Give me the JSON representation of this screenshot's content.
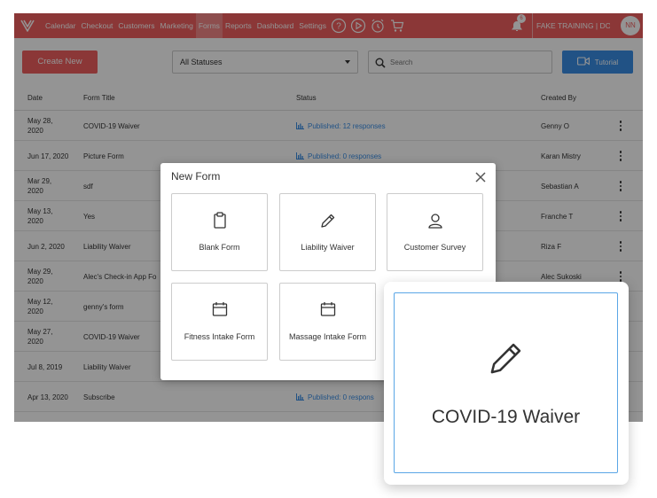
{
  "nav": {
    "items": [
      "Calendar",
      "Checkout",
      "Customers",
      "Marketing",
      "Forms",
      "Reports",
      "Dashboard",
      "Settings"
    ],
    "active": "Forms",
    "notification_count": "6",
    "account": "FAKE TRAINING | DO NO",
    "avatar_initials": "NN"
  },
  "toolbar": {
    "create_label": "Create New",
    "status_value": "All Statuses",
    "search_placeholder": "Search",
    "tutorial_label": "Tutorial"
  },
  "table": {
    "headers": {
      "date": "Date",
      "title": "Form Title",
      "status": "Status",
      "created": "Created By"
    },
    "rows": [
      {
        "date": "May 28,\n2020",
        "title": "COVID-19 Waiver",
        "status": "Published: 12 responses",
        "created": "Genny O"
      },
      {
        "date": "Jun 17, 2020",
        "title": "Picture Form",
        "status": "Published: 0 responses",
        "created": "Karan Mistry"
      },
      {
        "date": "Mar 29,\n2020",
        "title": "sdf",
        "status": "",
        "created": "Sebastian A"
      },
      {
        "date": "May 13,\n2020",
        "title": "Yes",
        "status": "",
        "created": "Franche T"
      },
      {
        "date": "Jun 2, 2020",
        "title": "Liability Waiver",
        "status": "",
        "created": "Riza F"
      },
      {
        "date": "May 29,\n2020",
        "title": "Alec's Check-in App Fo",
        "status": "",
        "created": "Alec Sukoski"
      },
      {
        "date": "May 12,\n2020",
        "title": "genny's form",
        "status": "",
        "created": ""
      },
      {
        "date": "May 27,\n2020",
        "title": "COVID-19 Waiver",
        "status": "",
        "created": ""
      },
      {
        "date": "Jul 8, 2019",
        "title": "Liability Waiver",
        "status": "",
        "created": ""
      },
      {
        "date": "Apr 13, 2020",
        "title": "Subscribe",
        "status": "Published: 0 respons",
        "created": ""
      }
    ]
  },
  "modal": {
    "title": "New Form",
    "cards": [
      {
        "label": "Blank Form",
        "icon": "clipboard-icon"
      },
      {
        "label": "Liability Waiver",
        "icon": "pencil-icon"
      },
      {
        "label": "Customer Survey",
        "icon": "person-icon"
      },
      {
        "label": "Fitness Intake Form",
        "icon": "calendar-icon"
      },
      {
        "label": "Massage Intake Form",
        "icon": "calendar-icon"
      }
    ]
  },
  "zoom": {
    "label": "COVID-19 Waiver",
    "icon": "pencil-icon"
  },
  "colors": {
    "brand": "#ef5f5f",
    "accent": "#3a8ee6"
  }
}
